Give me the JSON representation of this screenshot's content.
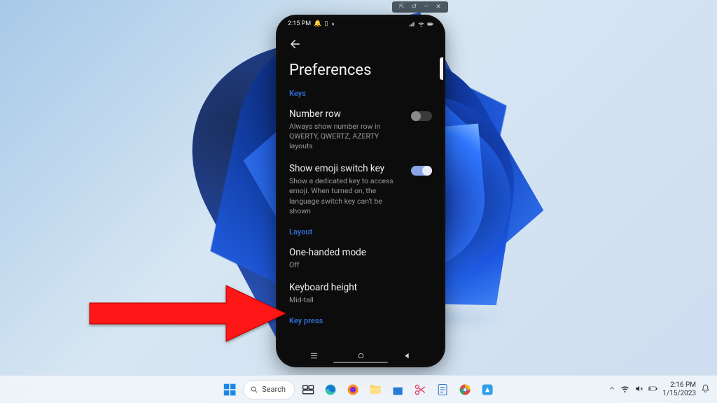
{
  "mirror_window": {
    "pin": "⇱",
    "undo": "↺",
    "min": "—",
    "close": "✕"
  },
  "phone": {
    "status": {
      "time": "2:15 PM",
      "bell": "🔔",
      "sim": "▯",
      "dnd": "◑"
    },
    "title": "Preferences",
    "sections": [
      {
        "key": "keys",
        "header": "Keys",
        "items": [
          {
            "key": "number-row",
            "label": "Number row",
            "sub": "Always show number row in QWERTY, QWERTZ, AZERTY layouts",
            "toggle": false
          },
          {
            "key": "emoji-switch",
            "label": "Show emoji switch key",
            "sub": "Show a dedicated key to access emoji. When turned on, the language switch key can't be shown",
            "toggle": true
          }
        ]
      },
      {
        "key": "layout",
        "header": "Layout",
        "items": [
          {
            "key": "one-handed",
            "label": "One-handed mode",
            "sub": "Off"
          },
          {
            "key": "kb-height",
            "label": "Keyboard height",
            "sub": "Mid-tall"
          }
        ]
      },
      {
        "key": "keypress",
        "header": "Key press",
        "items": []
      }
    ]
  },
  "taskbar": {
    "search": "Search",
    "clock": {
      "time": "2:16 PM",
      "date": "1/15/2023"
    }
  }
}
